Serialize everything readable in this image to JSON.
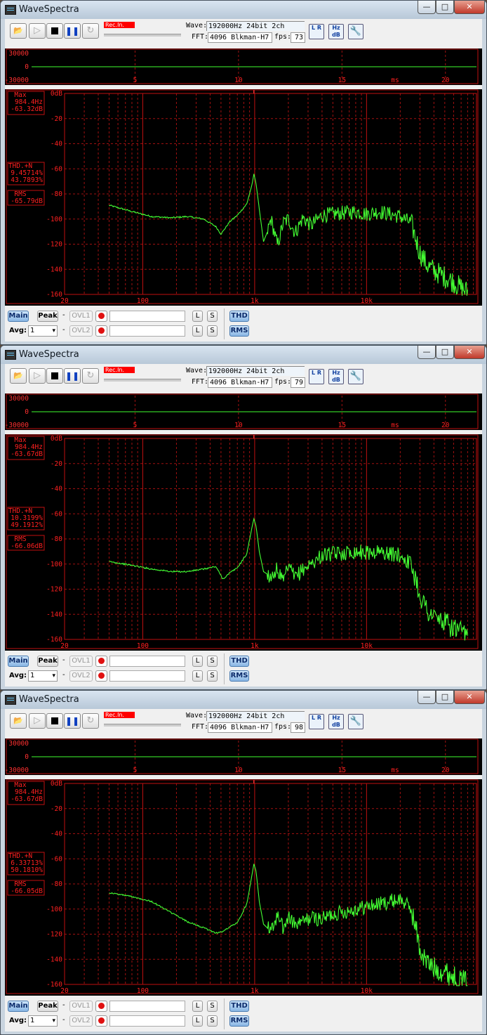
{
  "windows": [
    {
      "title": "WaveSpectra",
      "rec_label": "Rec.In.",
      "wave_label": "Wave:",
      "wave_value": "192000Hz 24bit 2ch",
      "fft_label": "FFT:",
      "fft_value": "4096 Blkman-H7",
      "fps_label": "fps:",
      "fps_value": "73",
      "max_label": "Max",
      "max_freq": "984.4Hz",
      "max_level": "-63.32dB",
      "thd_label": "THD.+N",
      "thd_value1": "9.45714%",
      "thd_value2": "43.7893%",
      "rms_label": "RMS",
      "rms_value": "-65.79dB"
    },
    {
      "title": "WaveSpectra",
      "rec_label": "Rec.In.",
      "wave_label": "Wave:",
      "wave_value": "192000Hz 24bit 2ch",
      "fft_label": "FFT:",
      "fft_value": "4096 Blkman-H7",
      "fps_label": "fps:",
      "fps_value": "79",
      "max_label": "Max",
      "max_freq": "984.4Hz",
      "max_level": "-63.67dB",
      "thd_label": "THD.+N",
      "thd_value1": "10.3199%",
      "thd_value2": "49.1912%",
      "rms_label": "RMS",
      "rms_value": "-66.06dB"
    },
    {
      "title": "WaveSpectra",
      "rec_label": "Rec.In.",
      "wave_label": "Wave:",
      "wave_value": "192000Hz 24bit 2ch",
      "fft_label": "FFT:",
      "fft_value": "4096 Blkman-H7",
      "fps_label": "fps:",
      "fps_value": "98",
      "max_label": "Max",
      "max_freq": "984.4Hz",
      "max_level": "-63.67dB",
      "thd_label": "THD.+N",
      "thd_value1": "6.33713%",
      "thd_value2": "50.1810%",
      "rms_label": "RMS",
      "rms_value": "-66.05dB"
    }
  ],
  "wave_axis": {
    "y_ticks": [
      "30000",
      "0",
      "-30000"
    ],
    "x_ticks": [
      "5",
      "10",
      "15",
      "20"
    ],
    "x_values": [
      5,
      10,
      15,
      20
    ],
    "x_range": [
      0,
      21.5
    ],
    "unit": "ms"
  },
  "spectrum_axis": {
    "y_ticks": [
      "0dB",
      "-20",
      "-40",
      "-60",
      "-80",
      "-100",
      "-120",
      "-140",
      "-160"
    ],
    "x_ticks": [
      "20",
      "100",
      "1k",
      "10k"
    ],
    "x_values": [
      20,
      100,
      1000,
      10000
    ],
    "x_range": [
      20,
      96000
    ],
    "y_range": [
      -160,
      0
    ],
    "peak_marker": 984.4
  },
  "window_buttons": {
    "minimize": "—",
    "maximize": "□",
    "close": "✕"
  },
  "toolbar_icons": [
    "open-icon",
    "play-icon",
    "stop-icon",
    "pause-icon",
    "loop-icon"
  ],
  "pause_glyph": "❚❚",
  "play_glyph": "▷",
  "loop_glyph": "↻",
  "lr_icon_text": "L R",
  "hz_icon_text": "Hz dB",
  "settings_glyph": "🔧",
  "open_glyph": "📂",
  "bottom": {
    "main_label": "Main",
    "peak_label": "Peak",
    "avg_label": "Avg:",
    "avg_value": "1",
    "dash": "-",
    "ovl1_label": "OVL1",
    "ovl2_label": "OVL2",
    "l_label": "L",
    "s_label": "S",
    "thd_button": "THD",
    "rms_button": "RMS"
  },
  "chart_data": [
    {
      "type": "line",
      "title": "",
      "xlabel": "",
      "ylabel": "",
      "x_scale": "log",
      "xlim": [
        20,
        96000
      ],
      "ylim": [
        -160,
        0
      ],
      "grid": true,
      "series": [
        {
          "x": [
            50,
            80,
            120,
            180,
            250,
            350,
            450,
            500,
            600,
            700,
            850,
            950,
            984,
            1030,
            1100,
            1200,
            1300,
            1400,
            1600,
            1800,
            2000,
            2300,
            2700,
            3200,
            4000,
            5000,
            6500,
            8000,
            10000,
            13000,
            16000,
            20000,
            25000,
            28000,
            30000,
            35000,
            40000,
            50000,
            60000,
            70000,
            80000
          ],
          "y": [
            -89,
            -94,
            -98,
            -99,
            -98,
            -100,
            -106,
            -112,
            -102,
            -97,
            -88,
            -72,
            -64,
            -72,
            -92,
            -118,
            -110,
            -100,
            -121,
            -103,
            -100,
            -111,
            -99,
            -105,
            -97,
            -96,
            -95,
            -94,
            -96,
            -94,
            -96,
            -98,
            -103,
            -118,
            -127,
            -137,
            -141,
            -146,
            -150,
            -155,
            -158
          ]
        }
      ]
    },
    {
      "type": "line",
      "title": "",
      "xlabel": "",
      "ylabel": "",
      "x_scale": "log",
      "xlim": [
        20,
        96000
      ],
      "ylim": [
        -160,
        0
      ],
      "grid": true,
      "series": [
        {
          "x": [
            50,
            80,
            120,
            180,
            250,
            350,
            450,
            520,
            600,
            700,
            850,
            950,
            984,
            1030,
            1100,
            1200,
            1400,
            1600,
            1800,
            2000,
            2300,
            2700,
            3200,
            4000,
            5000,
            6500,
            8000,
            10000,
            13000,
            16000,
            20000,
            25000,
            28000,
            30000,
            35000,
            40000,
            50000,
            60000,
            70000,
            80000
          ],
          "y": [
            -98,
            -101,
            -104,
            -106,
            -106,
            -104,
            -102,
            -112,
            -107,
            -103,
            -92,
            -70,
            -64,
            -70,
            -90,
            -106,
            -110,
            -104,
            -115,
            -102,
            -111,
            -104,
            -100,
            -93,
            -92,
            -91,
            -90,
            -91,
            -90,
            -92,
            -93,
            -100,
            -114,
            -125,
            -137,
            -142,
            -147,
            -151,
            -155,
            -158
          ]
        }
      ]
    },
    {
      "type": "line",
      "title": "",
      "xlabel": "",
      "ylabel": "",
      "x_scale": "log",
      "xlim": [
        20,
        96000
      ],
      "ylim": [
        -160,
        0
      ],
      "grid": true,
      "series": [
        {
          "x": [
            50,
            80,
            120,
            180,
            250,
            350,
            450,
            520,
            600,
            700,
            850,
            950,
            984,
            1030,
            1100,
            1200,
            1400,
            1600,
            1800,
            2000,
            2300,
            2700,
            3200,
            4000,
            5000,
            6500,
            8000,
            10000,
            13000,
            16000,
            20000,
            25000,
            28000,
            30000,
            35000,
            40000,
            50000,
            60000,
            70000,
            80000
          ],
          "y": [
            -87,
            -90,
            -94,
            -103,
            -110,
            -115,
            -119,
            -118,
            -114,
            -111,
            -96,
            -72,
            -64,
            -70,
            -94,
            -112,
            -118,
            -105,
            -116,
            -106,
            -113,
            -110,
            -107,
            -108,
            -104,
            -102,
            -100,
            -98,
            -96,
            -94,
            -92,
            -100,
            -118,
            -133,
            -143,
            -147,
            -150,
            -154,
            -157,
            -158
          ]
        }
      ]
    }
  ]
}
